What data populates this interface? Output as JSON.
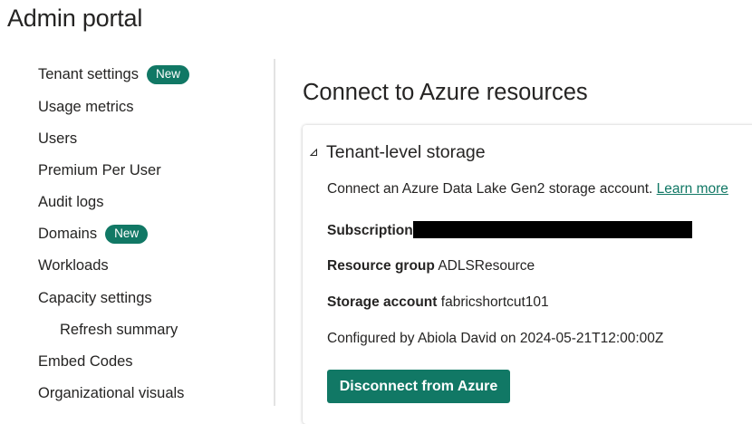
{
  "app": {
    "title": "Admin portal"
  },
  "sidebar": {
    "items": [
      {
        "label": "Tenant settings",
        "badge": "New"
      },
      {
        "label": "Usage metrics"
      },
      {
        "label": "Users"
      },
      {
        "label": "Premium Per User"
      },
      {
        "label": "Audit logs"
      },
      {
        "label": "Domains",
        "badge": "New"
      },
      {
        "label": "Workloads"
      },
      {
        "label": "Capacity settings"
      },
      {
        "label": "Refresh summary",
        "sub": true
      },
      {
        "label": "Embed Codes"
      },
      {
        "label": "Organizational visuals"
      }
    ]
  },
  "main": {
    "title": "Connect to Azure resources",
    "section": {
      "title": "Tenant-level storage",
      "collapse_icon": "collapse-triangle-icon",
      "description": "Connect an Azure Data Lake Gen2 storage account.",
      "learn_more": "Learn more",
      "subscription_label": "Subscription",
      "resource_group_label": "Resource group",
      "resource_group_value": "ADLSResource",
      "storage_account_label": "Storage account",
      "storage_account_value": "fabricshortcut101",
      "configured_text": "Configured by Abiola David on 2024-05-21T12:00:00Z",
      "disconnect_label": "Disconnect from Azure"
    }
  },
  "colors": {
    "accent": "#117865",
    "text": "#252423",
    "divider": "#e3e3e3"
  }
}
